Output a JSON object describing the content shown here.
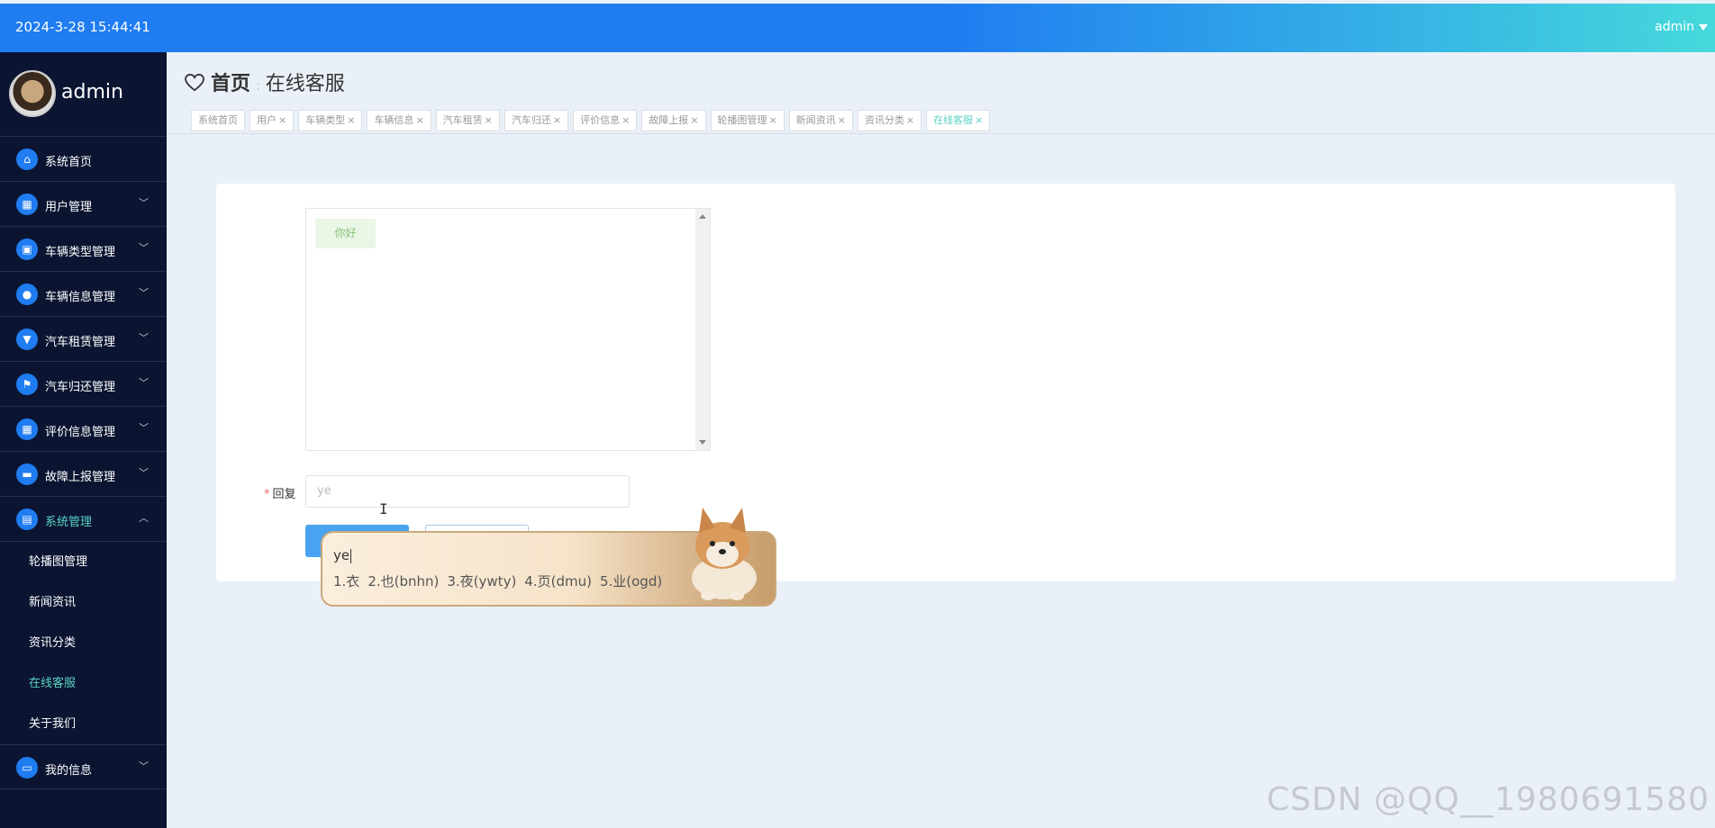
{
  "header": {
    "datetime": "2024-3-28 15:44:41",
    "user": "admin"
  },
  "sidebar": {
    "profile_name": "admin",
    "items": [
      {
        "label": "系统首页",
        "icon": "home-icon",
        "has_chevron": false
      },
      {
        "label": "用户管理",
        "icon": "grid-icon",
        "has_chevron": true
      },
      {
        "label": "车辆类型管理",
        "icon": "image-icon",
        "has_chevron": true
      },
      {
        "label": "车辆信息管理",
        "icon": "location-icon",
        "has_chevron": true
      },
      {
        "label": "汽车租赁管理",
        "icon": "trophy-icon",
        "has_chevron": true
      },
      {
        "label": "汽车归还管理",
        "icon": "flag-icon",
        "has_chevron": true
      },
      {
        "label": "评价信息管理",
        "icon": "grid-icon",
        "has_chevron": true
      },
      {
        "label": "故障上报管理",
        "icon": "briefcase-icon",
        "has_chevron": true
      },
      {
        "label": "系统管理",
        "icon": "document-icon",
        "has_chevron": true,
        "expanded": true
      }
    ],
    "sub_items": [
      "轮播图管理",
      "新闻资讯",
      "资讯分类",
      "在线客服",
      "关于我们"
    ],
    "active_sub": "在线客服",
    "last_item": {
      "label": "我的信息",
      "icon": "card-icon"
    }
  },
  "breadcrumb": {
    "home": "首页",
    "current": "在线客服"
  },
  "tabs": [
    {
      "label": "系统首页",
      "closable": false
    },
    {
      "label": "用户",
      "closable": true
    },
    {
      "label": "车辆类型",
      "closable": true
    },
    {
      "label": "车辆信息",
      "closable": true
    },
    {
      "label": "汽车租赁",
      "closable": true
    },
    {
      "label": "汽车归还",
      "closable": true
    },
    {
      "label": "评价信息",
      "closable": true
    },
    {
      "label": "故障上报",
      "closable": true
    },
    {
      "label": "轮播图管理",
      "closable": true
    },
    {
      "label": "新闻资讯",
      "closable": true
    },
    {
      "label": "资讯分类",
      "closable": true
    },
    {
      "label": "在线客服",
      "closable": true,
      "active": true
    }
  ],
  "chat": {
    "messages": [
      "你好"
    ]
  },
  "form": {
    "reply_label": "回复",
    "reply_value": "ye"
  },
  "ime": {
    "composition": "ye",
    "candidates": [
      "1.衣",
      "2.也(bnhn)",
      "3.夜(ywty)",
      "4.页(dmu)",
      "5.业(ogd)"
    ]
  },
  "watermark": "CSDN @QQ__1980691580",
  "colors": {
    "topbar_start": "#1f7cf1",
    "topbar_end": "#46d9dc",
    "sidebar_bg": "#0b1532",
    "accent": "#5ad1c3"
  }
}
